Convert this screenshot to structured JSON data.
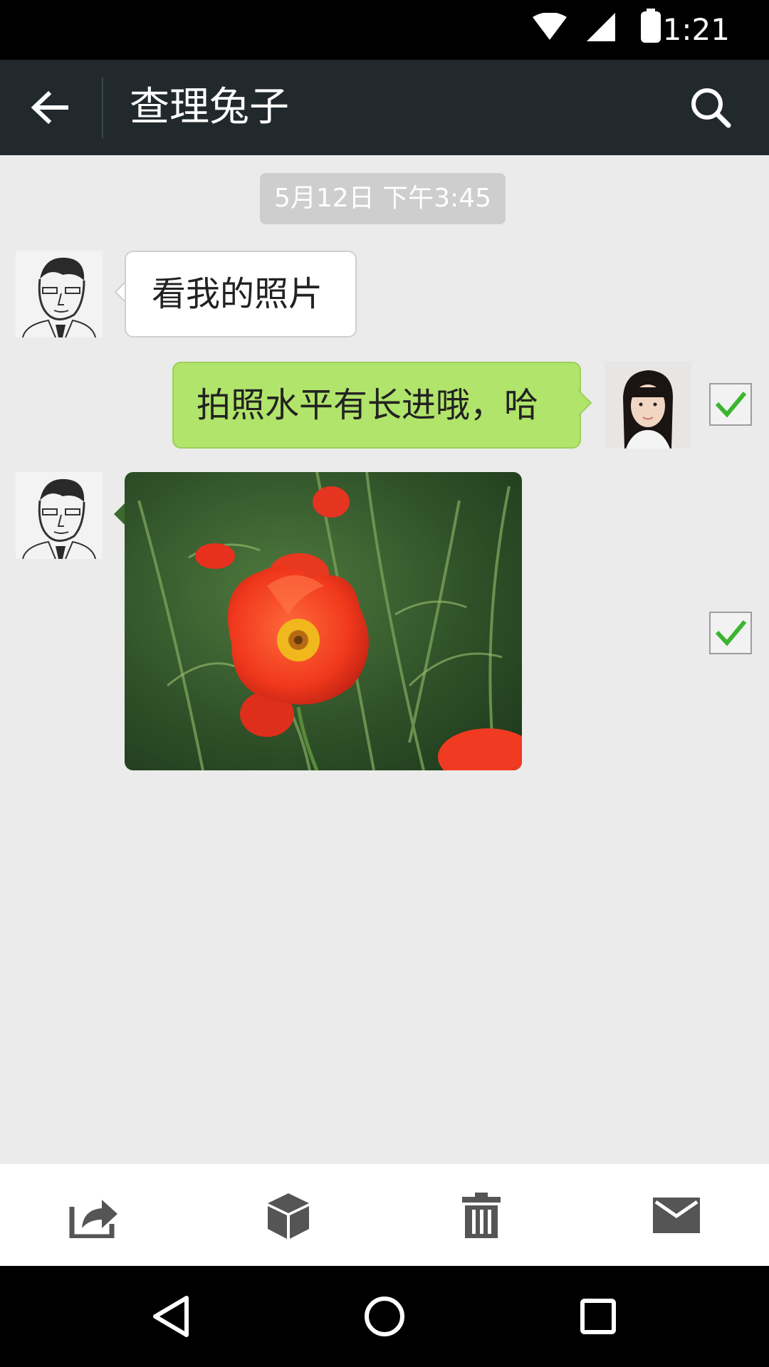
{
  "status_bar": {
    "time": "1:21",
    "icons": [
      "wifi-icon",
      "signal-icon",
      "battery-icon"
    ]
  },
  "title_bar": {
    "title": "查理兔子",
    "back_icon": "arrow-left-icon",
    "search_icon": "search-icon"
  },
  "chat": {
    "timestamp": "5月12日 下午3:45",
    "messages": [
      {
        "direction": "incoming",
        "type": "text",
        "text": "看我的照片",
        "selected": false
      },
      {
        "direction": "outgoing",
        "type": "text",
        "text": "拍照水平有长进哦，哈",
        "selected": true
      },
      {
        "direction": "incoming",
        "type": "image",
        "image_subject": "red poppy flowers",
        "selected": true
      }
    ]
  },
  "action_bar": {
    "items": [
      "share-icon",
      "box-icon",
      "trash-icon",
      "mail-icon"
    ]
  },
  "nav_bar": {
    "items": [
      "back-triangle-icon",
      "home-circle-icon",
      "recents-square-icon"
    ]
  },
  "colors": {
    "title_bar_bg": "#22292c",
    "chat_bg": "#ebebeb",
    "outgoing_bubble": "#b1e46a",
    "check_green": "#3cb52f"
  }
}
